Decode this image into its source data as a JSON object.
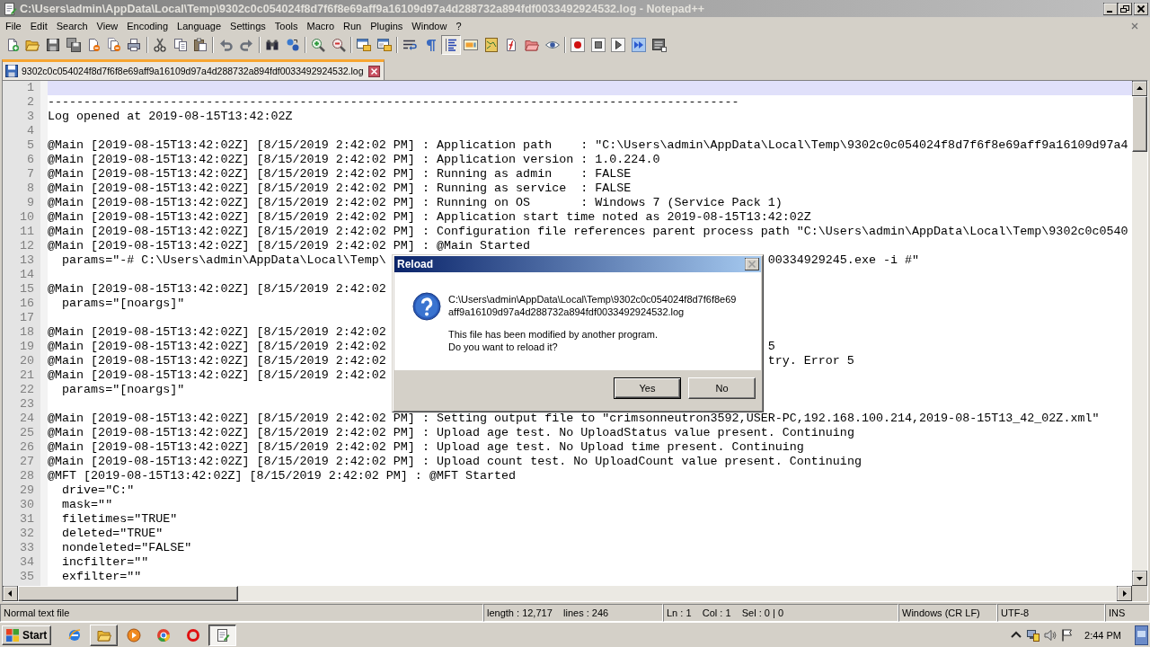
{
  "window": {
    "title": "C:\\Users\\admin\\AppData\\Local\\Temp\\9302c0c054024f8d7f6f8e69aff9a16109d97a4d288732a894fdf0033492924532.log - Notepad++",
    "active": false
  },
  "menu": [
    "File",
    "Edit",
    "Search",
    "View",
    "Encoding",
    "Language",
    "Settings",
    "Tools",
    "Macro",
    "Run",
    "Plugins",
    "Window",
    "?"
  ],
  "toolbar": [
    [
      {
        "kind": "new",
        "pressed": false
      },
      {
        "kind": "open",
        "pressed": false
      },
      {
        "kind": "save",
        "pressed": false
      },
      {
        "kind": "save_all",
        "pressed": false
      },
      {
        "kind": "close",
        "pressed": false
      },
      {
        "kind": "close_all",
        "pressed": false
      },
      {
        "kind": "print",
        "pressed": false
      }
    ],
    [
      {
        "kind": "cut",
        "pressed": false
      },
      {
        "kind": "copy",
        "pressed": false
      },
      {
        "kind": "paste",
        "pressed": false
      }
    ],
    [
      {
        "kind": "undo",
        "pressed": false
      },
      {
        "kind": "redo",
        "pressed": false
      }
    ],
    [
      {
        "kind": "find",
        "pressed": false
      },
      {
        "kind": "replace",
        "pressed": false
      }
    ],
    [
      {
        "kind": "zoom_in",
        "pressed": false
      },
      {
        "kind": "zoom_out",
        "pressed": false
      }
    ],
    [
      {
        "kind": "sync_v",
        "pressed": false
      },
      {
        "kind": "sync_h",
        "pressed": false
      }
    ],
    [
      {
        "kind": "wrap",
        "pressed": false
      },
      {
        "kind": "all_chars",
        "pressed": false
      },
      {
        "kind": "indent_guide",
        "pressed": true
      },
      {
        "kind": "udl",
        "pressed": false
      },
      {
        "kind": "doc_map",
        "pressed": false
      },
      {
        "kind": "func_list",
        "pressed": false
      },
      {
        "kind": "workspace",
        "pressed": false
      },
      {
        "kind": "monitor",
        "pressed": false
      }
    ],
    [
      {
        "kind": "record",
        "pressed": false
      },
      {
        "kind": "stop",
        "pressed": false
      },
      {
        "kind": "play",
        "pressed": false
      },
      {
        "kind": "play_multi",
        "pressed": false
      },
      {
        "kind": "save_macro",
        "pressed": false
      }
    ]
  ],
  "tabs": [
    {
      "label": "9302c0c054024f8d7f6f8e69aff9a16109d97a4d288732a894fdf0033492924532.log",
      "selected": true
    }
  ],
  "editor": {
    "lines": [
      {
        "n": "1",
        "current": true
      },
      {
        "n": "2",
        "text": "------------------------------------------------------------------------------------------------",
        "current": false
      },
      {
        "n": "3",
        "text": "Log opened at 2019-08-15T13:42:02Z",
        "current": false
      },
      {
        "n": "4",
        "current": false
      },
      {
        "n": "5",
        "text": "@Main [2019-08-15T13:42:02Z] [8/15/2019 2:42:02 PM] : Application path    : \"C:\\Users\\admin\\AppData\\Local\\Temp\\9302c0c054024f8d7f6f8e69aff9a16109d97a4",
        "current": false
      },
      {
        "n": "6",
        "text": "@Main [2019-08-15T13:42:02Z] [8/15/2019 2:42:02 PM] : Application version : 1.0.224.0",
        "current": false
      },
      {
        "n": "7",
        "text": "@Main [2019-08-15T13:42:02Z] [8/15/2019 2:42:02 PM] : Running as admin    : FALSE",
        "current": false
      },
      {
        "n": "8",
        "text": "@Main [2019-08-15T13:42:02Z] [8/15/2019 2:42:02 PM] : Running as service  : FALSE",
        "current": false
      },
      {
        "n": "9",
        "text": "@Main [2019-08-15T13:42:02Z] [8/15/2019 2:42:02 PM] : Running on OS       : Windows 7 (Service Pack 1)",
        "current": false
      },
      {
        "n": "10",
        "text": "@Main [2019-08-15T13:42:02Z] [8/15/2019 2:42:02 PM] : Application start time noted as 2019-08-15T13:42:02Z",
        "current": false
      },
      {
        "n": "11",
        "text": "@Main [2019-08-15T13:42:02Z] [8/15/2019 2:42:02 PM] : Configuration file references parent process path \"C:\\Users\\admin\\AppData\\Local\\Temp\\9302c0c0540",
        "current": false
      },
      {
        "n": "12",
        "text": "@Main [2019-08-15T13:42:02Z] [8/15/2019 2:42:02 PM] : @Main Started",
        "current": false
      },
      {
        "n": "13",
        "text": "  params=\"-# C:\\Users\\admin\\AppData\\Local\\Temp\\",
        "text_after_dialog": "00334929245.exe -i #\"",
        "current": false
      },
      {
        "n": "14",
        "current": false
      },
      {
        "n": "15",
        "text": "@Main [2019-08-15T13:42:02Z] [8/15/2019 2:42:02",
        "current": false
      },
      {
        "n": "16",
        "text": "  params=\"[noargs]\"",
        "current": false
      },
      {
        "n": "17",
        "current": false
      },
      {
        "n": "18",
        "text": "@Main [2019-08-15T13:42:02Z] [8/15/2019 2:42:02",
        "current": false
      },
      {
        "n": "19",
        "text": "@Main [2019-08-15T13:42:02Z] [8/15/2019 2:42:02",
        "text_after_dialog": "5",
        "current": false
      },
      {
        "n": "20",
        "text": "@Main [2019-08-15T13:42:02Z] [8/15/2019 2:42:02",
        "text_after_dialog": "try. Error 5",
        "current": false
      },
      {
        "n": "21",
        "text": "@Main [2019-08-15T13:42:02Z] [8/15/2019 2:42:02",
        "current": false
      },
      {
        "n": "22",
        "text": "  params=\"[noargs]\"",
        "current": false
      },
      {
        "n": "23",
        "current": false
      },
      {
        "n": "24",
        "text": "@Main [2019-08-15T13:42:02Z] [8/15/2019 2:42:02 PM] : Setting output file to \"crimsonneutron3592,USER-PC,192.168.100.214,2019-08-15T13_42_02Z.xml\"",
        "current": false
      },
      {
        "n": "25",
        "text": "@Main [2019-08-15T13:42:02Z] [8/15/2019 2:42:02 PM] : Upload age test. No UploadStatus value present. Continuing",
        "current": false
      },
      {
        "n": "26",
        "text": "@Main [2019-08-15T13:42:02Z] [8/15/2019 2:42:02 PM] : Upload age test. No Upload time present. Continuing",
        "current": false
      },
      {
        "n": "27",
        "text": "@Main [2019-08-15T13:42:02Z] [8/15/2019 2:42:02 PM] : Upload count test. No UploadCount value present. Continuing",
        "current": false
      },
      {
        "n": "28",
        "text": "@MFT [2019-08-15T13:42:02Z] [8/15/2019 2:42:02 PM] : @MFT Started",
        "current": false
      },
      {
        "n": "29",
        "text": "  drive=\"C:\"",
        "current": false
      },
      {
        "n": "30",
        "text": "  mask=\"\"",
        "current": false
      },
      {
        "n": "31",
        "text": "  filetimes=\"TRUE\"",
        "current": false
      },
      {
        "n": "32",
        "text": "  deleted=\"TRUE\"",
        "current": false
      },
      {
        "n": "33",
        "text": "  nondeleted=\"FALSE\"",
        "current": false
      },
      {
        "n": "34",
        "text": "  incfilter=\"\"",
        "current": false
      },
      {
        "n": "35",
        "text": "  exfilter=\"\"",
        "current": false
      }
    ]
  },
  "status_bar": [
    "Normal text file",
    "length : 12,717    lines : 246",
    "Ln : 1    Col : 1    Sel : 0 | 0",
    "Windows (CR LF)",
    "UTF-8",
    "INS"
  ],
  "dialog": {
    "title": "Reload",
    "file_path_lines": [
      "C:\\Users\\admin\\AppData\\Local\\Temp\\9302c0c054024f8d7f6f8e69",
      "aff9a16109d97a4d288732a894fdf0033492924532.log"
    ],
    "message_lines": [
      "This file has been modified by another program.",
      "Do you want to reload it?"
    ],
    "buttons": [
      {
        "label": "Yes",
        "default": true
      },
      {
        "label": "No",
        "default": false
      }
    ]
  },
  "taskbar": {
    "start": "Start",
    "apps": [
      {
        "kind": "ie",
        "open": false,
        "selected": false
      },
      {
        "kind": "explorer",
        "open": true,
        "selected": false
      },
      {
        "kind": "media",
        "open": false,
        "selected": false
      },
      {
        "kind": "chrome",
        "open": false,
        "selected": false
      },
      {
        "kind": "opera",
        "open": false,
        "selected": false
      },
      {
        "kind": "notepad",
        "open": true,
        "selected": true
      }
    ],
    "clock": "2:44 PM"
  }
}
